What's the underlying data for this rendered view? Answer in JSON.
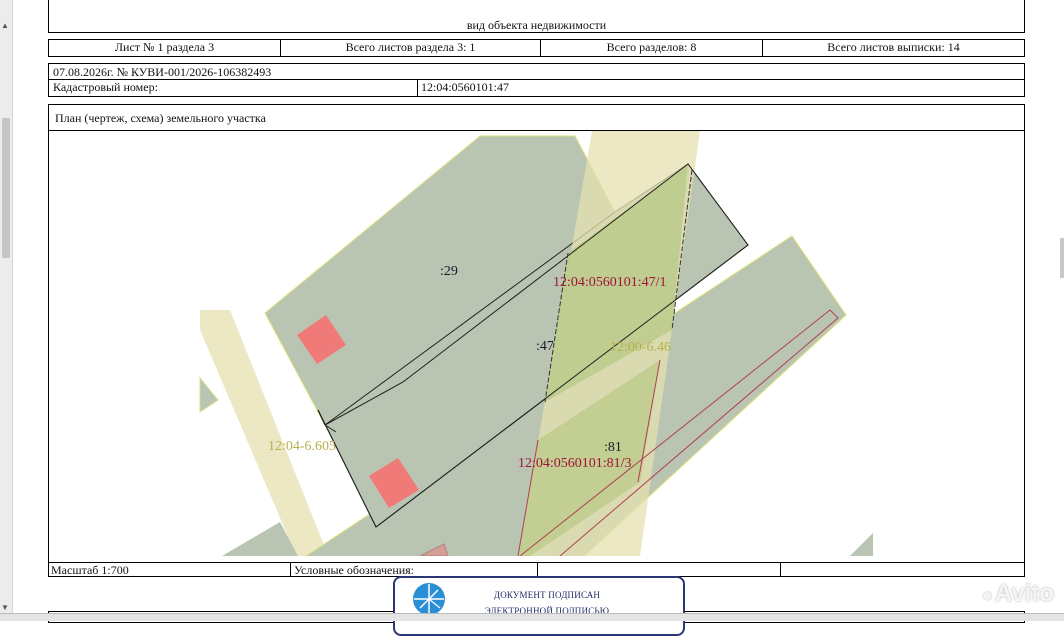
{
  "header": {
    "object_type": "вид объекта недвижимости",
    "sheet_label": "Лист № 1 раздела 3",
    "total_sheets_section": "Всего листов раздела 3: 1",
    "total_sections": "Всего разделов: 8",
    "total_sheets_extract": "Всего листов выписки: 14"
  },
  "doc_info": {
    "date_number": "07.08.2026г. № КУВИ-001/2026-106382493",
    "cadastral_label": "Кадастровый номер:",
    "cadastral_value": "12:04:0560101:47"
  },
  "plan": {
    "title": "План (чертеж, схема) земельного участка",
    "labels": {
      "parcel_29": ":29",
      "parcel_47_1": "12:04:0560101:47/1",
      "parcel_47": ":47",
      "zone_646": "12:00-6.46",
      "zone_6605": "12:04-6.605",
      "parcel_81": ":81",
      "parcel_81_3": "12:04:0560101:81/3"
    },
    "colors": {
      "parcel_fill": "#b9c5b2",
      "zone_fill": "#ede8c4",
      "overlap_fill": "#bfcc8f",
      "building_fill": "#f07a78",
      "label_dark": "#1a1a2e",
      "label_red": "#a0143a",
      "label_olive": "#b8b04a"
    }
  },
  "footer": {
    "scale": "Масштаб 1:700",
    "legend_label": "Условные обозначения:"
  },
  "stamp": {
    "line1": "ДОКУМЕНТ ПОДПИСАН",
    "line2": "ЭЛЕКТРОННОЙ ПОДПИСЬЮ"
  },
  "watermark": "Avito"
}
